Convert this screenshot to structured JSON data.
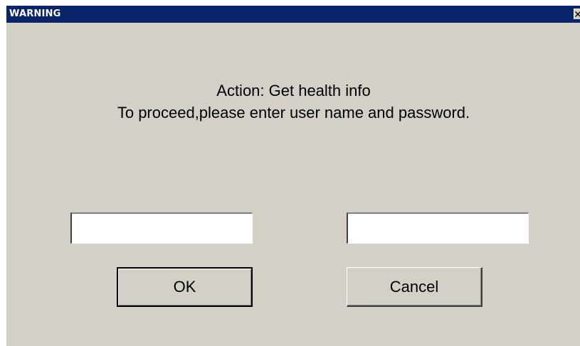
{
  "window": {
    "title": "WARNING",
    "close_icon": "close-icon"
  },
  "message": {
    "line1": "Action: Get health info",
    "line2": "To proceed,please enter user name and password."
  },
  "fields": {
    "username_value": "",
    "password_value": ""
  },
  "buttons": {
    "ok_label": "OK",
    "cancel_label": "Cancel"
  },
  "colors": {
    "titlebar": "#0a246a",
    "dialog_background": "#d4d0c8",
    "title_text": "#ffffff"
  }
}
